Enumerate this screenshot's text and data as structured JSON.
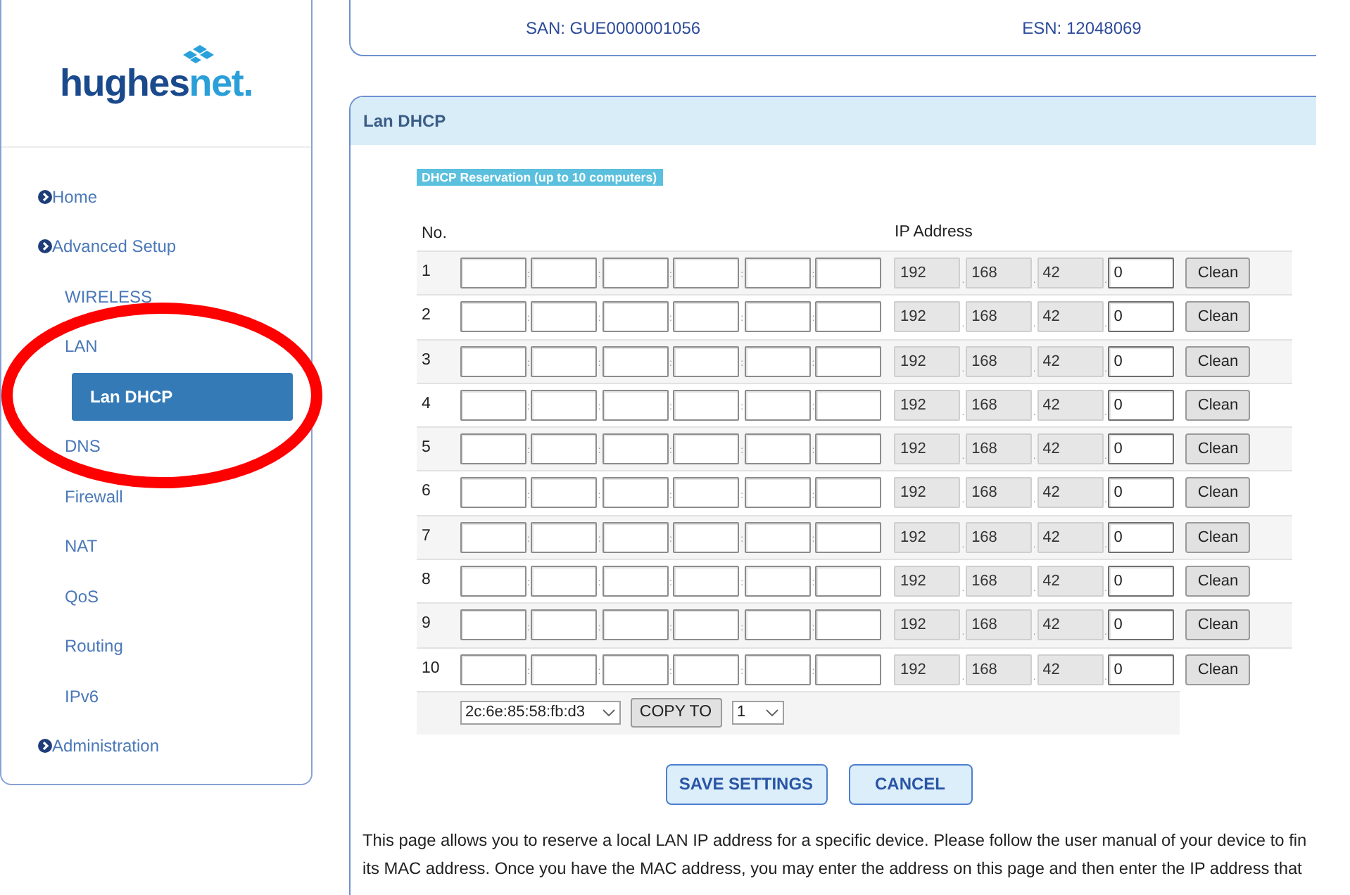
{
  "sidebar": {
    "logo": {
      "primary": "hughes",
      "accent": "net."
    },
    "nav": [
      {
        "label": "Home",
        "selected": false
      },
      {
        "label": "Advanced Setup",
        "selected": false,
        "children": [
          {
            "label": "WIRELESS",
            "selected": false
          },
          {
            "label": "LAN",
            "selected": false,
            "children": [
              {
                "label": "Lan DHCP",
                "selected": true
              }
            ]
          },
          {
            "label": "DNS",
            "selected": false
          },
          {
            "label": "Firewall",
            "selected": false
          },
          {
            "label": "NAT",
            "selected": false
          },
          {
            "label": "QoS",
            "selected": false
          },
          {
            "label": "Routing",
            "selected": false
          },
          {
            "label": "IPv6",
            "selected": false
          }
        ]
      },
      {
        "label": "Administration",
        "selected": false
      }
    ]
  },
  "device_info": [
    "SAN: GUE0000001056",
    "ESN: 12048069"
  ],
  "panel": {
    "title": "Lan DHCP",
    "section_label": "DHCP Reservation (up to 10 computers)",
    "columns": {
      "no": "No.",
      "ip": "IP Address"
    },
    "rows": [
      {
        "no": "1",
        "mac_separators": [
          ":",
          ":",
          ":",
          ":",
          ":"
        ],
        "ip": [
          {
            "value": "192",
            "disabled": true
          },
          {
            "value": "168",
            "disabled": true
          },
          {
            "value": "42",
            "disabled": true
          },
          {
            "value": "0",
            "disabled": false
          }
        ],
        "ip_separators": [
          ".",
          ".",
          "."
        ],
        "button": "Clean"
      },
      {
        "no": "2",
        "mac_separators": [
          ":",
          ":",
          ":",
          ":",
          ":"
        ],
        "ip": [
          {
            "value": "192",
            "disabled": true
          },
          {
            "value": "168",
            "disabled": true
          },
          {
            "value": "42",
            "disabled": true
          },
          {
            "value": "0",
            "disabled": false
          }
        ],
        "ip_separators": [
          ".",
          ".",
          "."
        ],
        "button": "Clean"
      },
      {
        "no": "3",
        "mac_separators": [
          ":",
          ":",
          ":",
          ":",
          ":"
        ],
        "ip": [
          {
            "value": "192",
            "disabled": true
          },
          {
            "value": "168",
            "disabled": true
          },
          {
            "value": "42",
            "disabled": true
          },
          {
            "value": "0",
            "disabled": false
          }
        ],
        "ip_separators": [
          ".",
          ".",
          "."
        ],
        "button": "Clean"
      },
      {
        "no": "4",
        "mac_separators": [
          ":",
          ":",
          ":",
          ":",
          ":"
        ],
        "ip": [
          {
            "value": "192",
            "disabled": true
          },
          {
            "value": "168",
            "disabled": true
          },
          {
            "value": "42",
            "disabled": true
          },
          {
            "value": "0",
            "disabled": false
          }
        ],
        "ip_separators": [
          ".",
          ".",
          "."
        ],
        "button": "Clean"
      },
      {
        "no": "5",
        "mac_separators": [
          ":",
          ":",
          ":",
          ":",
          ":"
        ],
        "ip": [
          {
            "value": "192",
            "disabled": true
          },
          {
            "value": "168",
            "disabled": true
          },
          {
            "value": "42",
            "disabled": true
          },
          {
            "value": "0",
            "disabled": false
          }
        ],
        "ip_separators": [
          ".",
          ".",
          "."
        ],
        "button": "Clean"
      },
      {
        "no": "6",
        "mac_separators": [
          ":",
          ":",
          ":",
          ":",
          ":"
        ],
        "ip": [
          {
            "value": "192",
            "disabled": true
          },
          {
            "value": "168",
            "disabled": true
          },
          {
            "value": "42",
            "disabled": true
          },
          {
            "value": "0",
            "disabled": false
          }
        ],
        "ip_separators": [
          ".",
          ".",
          "."
        ],
        "button": "Clean"
      },
      {
        "no": "7",
        "mac_separators": [
          ":",
          ":",
          ":",
          ":",
          ":"
        ],
        "ip": [
          {
            "value": "192",
            "disabled": true
          },
          {
            "value": "168",
            "disabled": true
          },
          {
            "value": "42",
            "disabled": true
          },
          {
            "value": "0",
            "disabled": false
          }
        ],
        "ip_separators": [
          ".",
          ".",
          "."
        ],
        "button": "Clean"
      },
      {
        "no": "8",
        "mac_separators": [
          ":",
          ":",
          ":",
          ":",
          ":"
        ],
        "ip": [
          {
            "value": "192",
            "disabled": true
          },
          {
            "value": "168",
            "disabled": true
          },
          {
            "value": "42",
            "disabled": true
          },
          {
            "value": "0",
            "disabled": false
          }
        ],
        "ip_separators": [
          ".",
          ".",
          "."
        ],
        "button": "Clean"
      },
      {
        "no": "9",
        "mac_separators": [
          ":",
          ":",
          ":",
          ":",
          ":"
        ],
        "ip": [
          {
            "value": "192",
            "disabled": true
          },
          {
            "value": "168",
            "disabled": true
          },
          {
            "value": "42",
            "disabled": true
          },
          {
            "value": "0",
            "disabled": false
          }
        ],
        "ip_separators": [
          ".",
          ".",
          "."
        ],
        "button": "Clean"
      },
      {
        "no": "10",
        "mac_separators": [
          ":",
          ":",
          ":",
          ":",
          ":"
        ],
        "ip": [
          {
            "value": "192",
            "disabled": true
          },
          {
            "value": "168",
            "disabled": true
          },
          {
            "value": "42",
            "disabled": true
          },
          {
            "value": "0",
            "disabled": false
          }
        ],
        "ip_separators": [
          ".",
          ".",
          "."
        ],
        "button": "Clean"
      }
    ],
    "copy_row": {
      "mac_select": "2c:6e:85:58:fb:d3",
      "button": "COPY TO",
      "target_select": "1"
    },
    "actions": [
      "SAVE SETTINGS",
      "CANCEL"
    ],
    "note_lines": [
      "This page allows you to reserve a local LAN IP address for a specific device. Please follow the user manual of your device to fin",
      "its MAC address. Once you have the MAC address, you may enter the address on this page and then enter the IP address that"
    ]
  }
}
